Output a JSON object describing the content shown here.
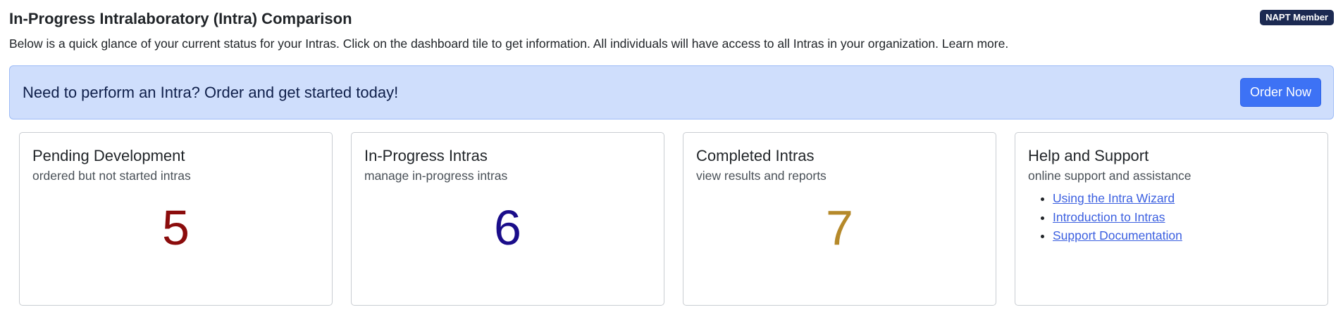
{
  "header": {
    "title": "In-Progress Intralaboratory (Intra) Comparison",
    "badge": "NAPT Member",
    "intro": "Below is a quick glance of your current status for your Intras. Click on the dashboard tile to get information. All individuals will have access to all Intras in your organization. Learn more."
  },
  "banner": {
    "text": "Need to perform an Intra? Order and get started today!",
    "button_label": "Order Now"
  },
  "tiles": [
    {
      "title": "Pending Development",
      "subtitle": "ordered but not started intras",
      "count": "5",
      "count_color": "#8b0c0c"
    },
    {
      "title": "In-Progress Intras",
      "subtitle": "manage in-progress intras",
      "count": "6",
      "count_color": "#1a0d8a"
    },
    {
      "title": "Completed Intras",
      "subtitle": "view results and reports",
      "count": "7",
      "count_color": "#b5892a"
    },
    {
      "title": "Help and Support",
      "subtitle": "online support and assistance",
      "links": [
        "Using the Intra Wizard",
        "Introduction to Intras",
        "Support Documentation"
      ]
    }
  ],
  "colors": {
    "banner_bg": "#cfdefc",
    "button": "#3d72f5",
    "badge": "#1c2a52",
    "link": "#3b5fe0"
  }
}
